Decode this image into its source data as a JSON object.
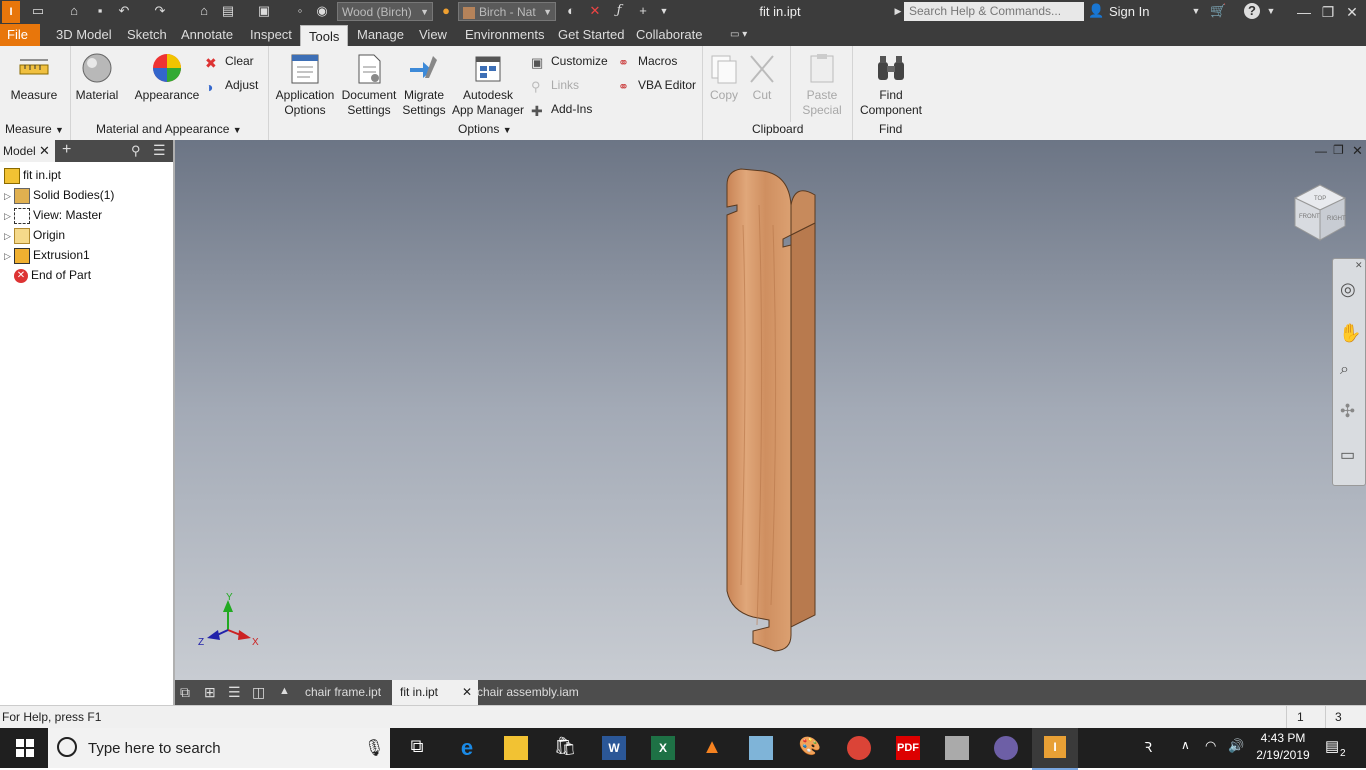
{
  "titlebar": {
    "material": "Wood (Birch)",
    "appearance": "Birch - Nat",
    "doc_title": "fit in.ipt",
    "search_placeholder": "Search Help & Commands...",
    "sign_in": "Sign In"
  },
  "menu_tabs": [
    "File",
    "3D Model",
    "Sketch",
    "Annotate",
    "Inspect",
    "Tools",
    "Manage",
    "View",
    "Environments",
    "Get Started",
    "Collaborate"
  ],
  "active_tab": "Tools",
  "ribbon": {
    "measure": "Measure",
    "material": "Material",
    "appearance": "Appearance",
    "clear": "Clear",
    "adjust": "Adjust",
    "app_options": [
      "Application",
      "Options"
    ],
    "doc_settings": [
      "Document",
      "Settings"
    ],
    "migrate": [
      "Migrate",
      "Settings"
    ],
    "app_manager": [
      "Autodesk",
      "App Manager"
    ],
    "customize": "Customize",
    "links": "Links",
    "add_ins": "Add-Ins",
    "macros": "Macros",
    "vba": "VBA Editor",
    "copy": "Copy",
    "cut": "Cut",
    "paste_special": [
      "Paste",
      "Special"
    ],
    "find_component": [
      "Find",
      "Component"
    ],
    "panels": {
      "measure": "Measure",
      "material_appearance": "Material and Appearance",
      "options": "Options",
      "clipboard": "Clipboard",
      "find": "Find"
    }
  },
  "browser": {
    "tab": "Model",
    "items": [
      "fit in.ipt",
      "Solid Bodies(1)",
      "View: Master",
      "Origin",
      "Extrusion1",
      "End of Part"
    ]
  },
  "viewcube": {
    "top": "TOP",
    "front": "FRONT",
    "right": "RIGHT"
  },
  "axes": {
    "x": "X",
    "y": "Y",
    "z": "Z"
  },
  "doc_tabs": [
    "chair frame.ipt",
    "fit in.ipt",
    "chair assembly.iam"
  ],
  "status": {
    "help": "For Help, press F1",
    "n1": "1",
    "n2": "3"
  },
  "taskbar": {
    "search": "Type here to search",
    "time": "4:43 PM",
    "date": "2/19/2019",
    "notif": "2"
  },
  "colors": {
    "file_tab": "#e8760b",
    "dark_bar": "#3c3c3c",
    "wood": "#d39a6a"
  }
}
